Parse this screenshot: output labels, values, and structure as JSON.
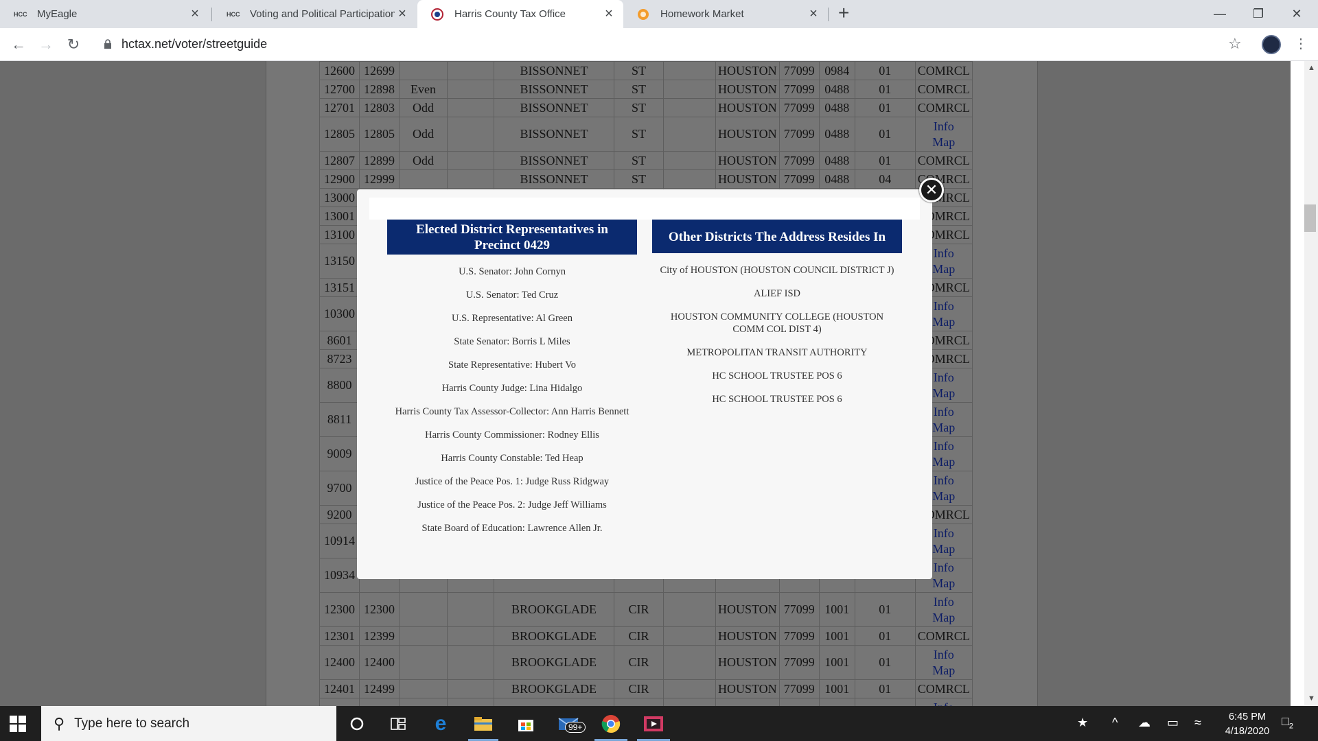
{
  "browser": {
    "tabs": [
      {
        "favicon": "HCC",
        "title": "MyEagle",
        "active": false
      },
      {
        "favicon": "HCC",
        "title": "Voting and Political Participation",
        "active": false
      },
      {
        "favicon": "seal",
        "title": "Harris County Tax Office",
        "active": true
      },
      {
        "favicon": "orange-circle",
        "title": "Homework Market",
        "active": false
      }
    ],
    "url": "hctax.net/voter/streetguide"
  },
  "street_table": {
    "rows": [
      [
        "12600",
        "12699",
        "",
        "",
        "BISSONNET",
        "ST",
        "",
        "HOUSTON",
        "77099",
        "0984",
        "01",
        "COMRCL"
      ],
      [
        "12700",
        "12898",
        "Even",
        "",
        "BISSONNET",
        "ST",
        "",
        "HOUSTON",
        "77099",
        "0488",
        "01",
        "COMRCL"
      ],
      [
        "12701",
        "12803",
        "Odd",
        "",
        "BISSONNET",
        "ST",
        "",
        "HOUSTON",
        "77099",
        "0488",
        "01",
        "COMRCL"
      ],
      [
        "12805",
        "12805",
        "Odd",
        "",
        "BISSONNET",
        "ST",
        "",
        "HOUSTON",
        "77099",
        "0488",
        "01",
        "Info Map"
      ],
      [
        "12807",
        "12899",
        "Odd",
        "",
        "BISSONNET",
        "ST",
        "",
        "HOUSTON",
        "77099",
        "0488",
        "01",
        "COMRCL"
      ],
      [
        "12900",
        "12999",
        "",
        "",
        "BISSONNET",
        "ST",
        "",
        "HOUSTON",
        "77099",
        "0488",
        "04",
        "COMRCL"
      ],
      [
        "13000",
        "",
        "",
        "",
        "",
        "",
        "",
        "",
        "",
        "",
        "",
        "COMRCL"
      ],
      [
        "13001",
        "",
        "",
        "",
        "",
        "",
        "",
        "",
        "",
        "",
        "",
        "COMRCL"
      ],
      [
        "13100",
        "",
        "",
        "",
        "",
        "",
        "",
        "",
        "",
        "",
        "",
        "COMRCL"
      ],
      [
        "13150",
        "",
        "",
        "",
        "",
        "",
        "",
        "",
        "",
        "",
        "",
        "Info Map"
      ],
      [
        "13151",
        "",
        "",
        "",
        "",
        "",
        "",
        "",
        "",
        "",
        "",
        "COMRCL"
      ],
      [
        "10300",
        "",
        "",
        "",
        "",
        "",
        "",
        "",
        "",
        "",
        "",
        "Info Map"
      ],
      [
        "8601",
        "",
        "",
        "",
        "",
        "",
        "",
        "",
        "",
        "",
        "",
        "COMRCL"
      ],
      [
        "8723",
        "",
        "",
        "",
        "",
        "",
        "",
        "",
        "",
        "",
        "",
        "COMRCL"
      ],
      [
        "8800",
        "",
        "",
        "",
        "",
        "",
        "",
        "",
        "",
        "",
        "",
        "Info Map"
      ],
      [
        "8811",
        "",
        "",
        "",
        "",
        "",
        "",
        "",
        "",
        "",
        "",
        "Info Map"
      ],
      [
        "9009",
        "",
        "",
        "",
        "",
        "",
        "",
        "",
        "",
        "",
        "",
        "Info Map"
      ],
      [
        "9700",
        "",
        "",
        "",
        "",
        "",
        "",
        "",
        "",
        "",
        "",
        "Info Map"
      ],
      [
        "9200",
        "",
        "",
        "",
        "",
        "",
        "",
        "",
        "",
        "",
        "",
        "COMRCL"
      ],
      [
        "10914",
        "",
        "",
        "",
        "",
        "",
        "",
        "",
        "",
        "",
        "",
        "Info Map"
      ],
      [
        "10934",
        "",
        "",
        "",
        "",
        "",
        "",
        "",
        "",
        "",
        "",
        "Info Map"
      ],
      [
        "12300",
        "12300",
        "",
        "",
        "BROOKGLADE",
        "CIR",
        "",
        "HOUSTON",
        "77099",
        "1001",
        "01",
        "Info Map"
      ],
      [
        "12301",
        "12399",
        "",
        "",
        "BROOKGLADE",
        "CIR",
        "",
        "HOUSTON",
        "77099",
        "1001",
        "01",
        "COMRCL"
      ],
      [
        "12400",
        "12400",
        "",
        "",
        "BROOKGLADE",
        "CIR",
        "",
        "HOUSTON",
        "77099",
        "1001",
        "01",
        "Info Map"
      ],
      [
        "12401",
        "12499",
        "",
        "",
        "BROOKGLADE",
        "CIR",
        "",
        "HOUSTON",
        "77099",
        "1001",
        "01",
        "COMRCL"
      ],
      [
        "",
        "",
        "",
        "",
        "",
        "",
        "",
        "",
        "",
        "",
        "",
        "Info"
      ]
    ]
  },
  "modal": {
    "left_heading": "Elected District Representatives in Precinct 0429",
    "left_items": [
      "U.S. Senator: John Cornyn",
      "U.S. Senator: Ted Cruz",
      "U.S. Representative: Al Green",
      "State Senator: Borris L Miles",
      "State Representative: Hubert Vo",
      "Harris County Judge: Lina Hidalgo",
      "Harris County Tax Assessor-Collector: Ann Harris Bennett",
      "Harris County Commissioner: Rodney Ellis",
      "Harris County Constable: Ted Heap",
      "Justice of the Peace Pos. 1: Judge Russ Ridgway",
      "Justice of the Peace Pos. 2: Judge Jeff Williams",
      "State Board of Education: Lawrence Allen Jr."
    ],
    "right_heading": "Other Districts The Address Resides In",
    "right_items": [
      "City of HOUSTON (HOUSTON COUNCIL DISTRICT J)",
      "ALIEF ISD",
      "HOUSTON COMMUNITY COLLEGE (HOUSTON COMM COL DIST 4)",
      "METROPOLITAN TRANSIT AUTHORITY",
      "HC SCHOOL TRUSTEE POS 6",
      "HC SCHOOL TRUSTEE POS 6"
    ]
  },
  "taskbar": {
    "search_placeholder": "Type here to search",
    "mail_badge": "99+",
    "time": "6:45 PM",
    "date": "4/18/2020",
    "notification_count": "2"
  },
  "colors": {
    "modal_heading_bg": "#0b2a6f",
    "link_color": "#0d1d66"
  }
}
